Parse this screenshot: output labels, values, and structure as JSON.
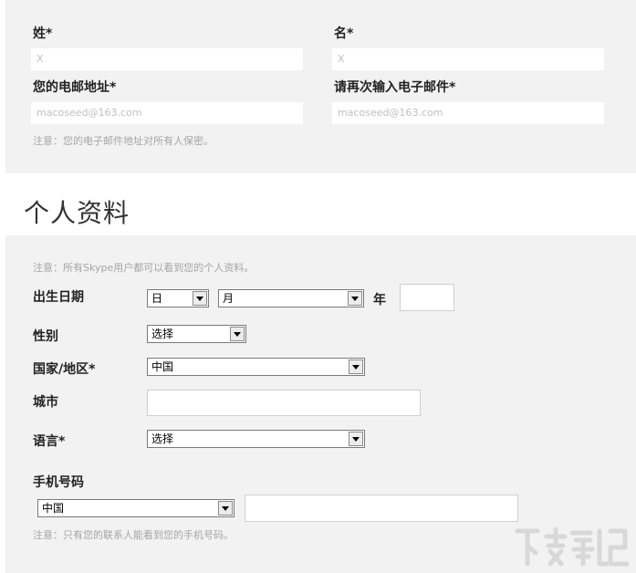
{
  "account": {
    "last_name_label": "姓*",
    "last_name_value": "X",
    "first_name_label": "名*",
    "first_name_value": "X",
    "email_label": "您的电邮地址*",
    "email_value": "macoseed@163.com",
    "confirm_email_label": "请再次输入电子邮件*",
    "confirm_email_value": "macoseed@163.com",
    "privacy_note": "注意：您的电子邮件地址对所有人保密。"
  },
  "profile": {
    "section_title": "个人资料",
    "visibility_note": "注意：所有Skype用户都可以看到您的个人资料。",
    "birthday_label": "出生日期",
    "day_value": "日",
    "month_value": "月",
    "year_label": "年",
    "gender_label": "性别",
    "gender_value": "选择",
    "country_label": "国家/地区*",
    "country_value": "中国",
    "city_label": "城市",
    "language_label": "语言*",
    "language_value": "选择",
    "mobile_label": "手机号码",
    "mobile_country_value": "中国",
    "mobile_note": "注意：只有您的联系人能看到您的手机号码。"
  },
  "colors": {
    "panel_bg": "#f2f2f2",
    "note_text": "#a5a5a5"
  }
}
